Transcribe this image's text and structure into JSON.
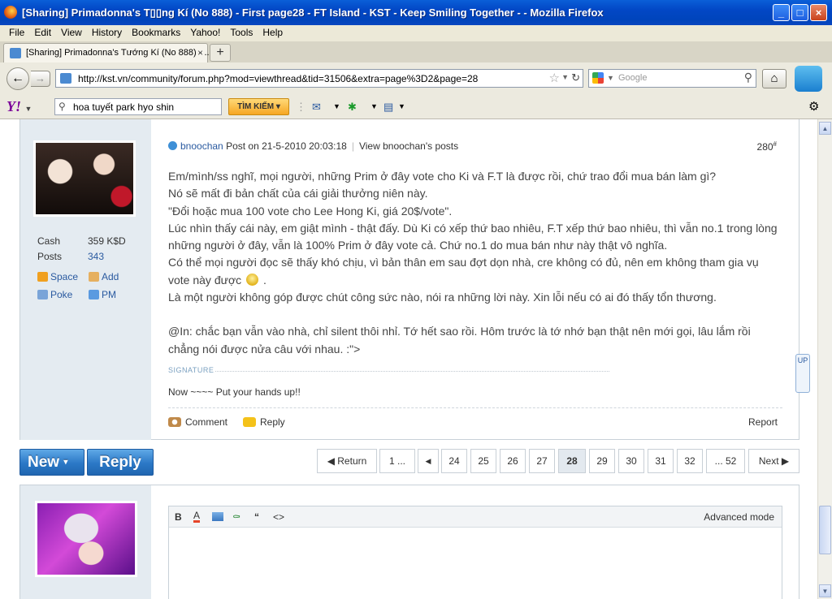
{
  "window": {
    "title": "[Sharing] Primadonna's T▯▯ng Kí (No 888) - First page28 - FT Island - KST - Keep Smiling Together - - Mozilla Firefox"
  },
  "menu": [
    "File",
    "Edit",
    "View",
    "History",
    "Bookmarks",
    "Yahoo!",
    "Tools",
    "Help"
  ],
  "tab": {
    "label": "[Sharing] Primadonna's Tướng Kí (No 888) - ...",
    "close": "×",
    "new_tab": "+"
  },
  "nav": {
    "url": "http://kst.vn/community/forum.php?mod=viewthread&tid=31506&extra=page%3D2&page=28",
    "search_placeholder": "Google"
  },
  "yahoo": {
    "logo": "Y!",
    "search_value": "hoa tuyết park hyo shin",
    "search_button": "TÌM KIẾM ▾"
  },
  "post": {
    "author": "bnoochan",
    "posted": "Post on 21-5-2010 20:03:18",
    "view_posts": "View bnoochan's posts",
    "floor": "280",
    "floor_mark": "#",
    "stats": {
      "cash_label": "Cash",
      "cash_value": "359 K$D",
      "posts_label": "Posts",
      "posts_value": "343"
    },
    "side_links": {
      "space": "Space",
      "add": "Add",
      "poke": "Poke",
      "pm": "PM"
    },
    "body": [
      "Em/mình/ss nghĩ, mọi người, những Prim ở đây vote cho Ki và F.T là được rồi, chứ trao đổi mua bán làm gì?",
      "Nó sẽ mất đi bản chất của cái giải thưởng niên này.",
      "\"Đổi hoặc mua 100 vote cho Lee Hong Ki, giá 20$/vote\".",
      "Lúc nhìn thấy cái này, em giật mình - thật đấy. Dù Ki có xếp thứ bao nhiêu, F.T xếp thứ bao nhiêu, thì vẫn no.1 trong lòng những người ở đây, vẫn là 100% Prim ở đây vote cả. Chứ no.1 do mua bán như này thật vô nghĩa.",
      "Có thể mọi người đọc sẽ thấy khó chịu, vì bản thân em sau đợt dọn nhà, cre không có đủ, nên em không tham gia vụ vote này được",
      ".",
      "Là một người không góp được chút công sức nào, nói ra những lời này. Xin lỗi nếu có ai đó thấy tổn thương.",
      "@In: chắc bạn vẫn vào nhà, chỉ silent thôi nhỉ. Tớ hết sao rồi. Hôm trước là tớ nhớ bạn thật nên mới gọi, lâu lắm rồi chẳng nói được nửa câu với nhau. :\">"
    ],
    "signature_label": "SIGNATURE",
    "signature_text": "Now ~~~~ Put your hands up!!",
    "comment": "Comment",
    "reply": "Reply",
    "report": "Report"
  },
  "actions": {
    "new": "New",
    "new_caret": "▾",
    "reply": "Reply"
  },
  "pagination": {
    "return": "Return",
    "first": "1 ...",
    "pages": [
      "24",
      "25",
      "26",
      "27",
      "28",
      "29",
      "30",
      "31",
      "32"
    ],
    "current": "28",
    "last": "... 52",
    "next": "Next"
  },
  "editor": {
    "bold": "B",
    "font_color": "A",
    "quote": "“",
    "code": "<>",
    "advanced_mode": "Advanced mode"
  },
  "float_widget": "UP"
}
